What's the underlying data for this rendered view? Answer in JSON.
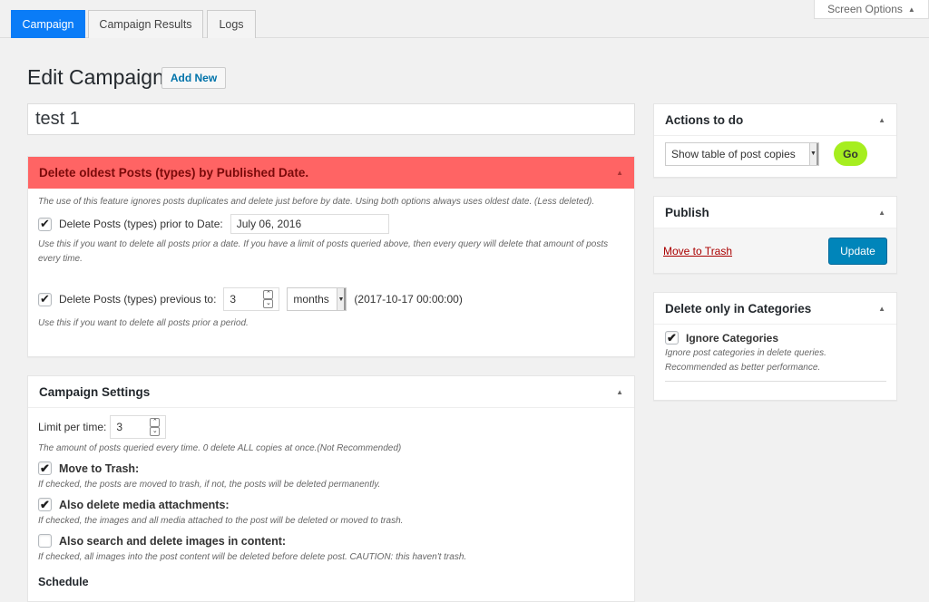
{
  "tabs": [
    {
      "label": "Campaign",
      "active": true
    },
    {
      "label": "Campaign Results"
    },
    {
      "label": "Logs"
    }
  ],
  "screen_options": "Screen Options",
  "page_title": "Edit Campaign",
  "add_new": "Add New",
  "campaign_title": "test 1",
  "delete_oldest": {
    "title": "Delete oldest Posts (types) by Published Date.",
    "header_color": "#ff6464",
    "intro": "The use of this feature ignores posts duplicates and delete just before by date. Using both options always uses oldest date. (Less deleted).",
    "prior_date_label": "Delete Posts (types) prior to Date:",
    "prior_date_checked": true,
    "prior_date_value": "July 06, 2016",
    "prior_date_help": "Use this if you want to delete all posts prior a date. If you have a limit of posts queried above, then every query will delete that amount of posts every time.",
    "previous_label": "Delete Posts (types) previous to:",
    "previous_checked": true,
    "previous_value": "3",
    "previous_unit": "months",
    "previous_computed": "(2017-10-17 00:00:00)",
    "previous_help": "Use this if you want to delete all posts prior a period."
  },
  "settings": {
    "title": "Campaign Settings",
    "limit_label": "Limit per time:",
    "limit_value": "3",
    "limit_help": "The amount of posts queried every time. 0 delete ALL copies at once.(Not Recommended)",
    "options": [
      {
        "label": "Move to Trash:",
        "checked": true,
        "help": "If checked, the posts are moved to trash, if not, the posts will be deleted permanently."
      },
      {
        "label": "Also delete media attachments:",
        "checked": true,
        "help": "If checked, the images and all media attached to the post will be deleted or moved to trash."
      },
      {
        "label": "Also search and delete images in content:",
        "checked": false,
        "help": "If checked, all images into the post content will be deleted before delete post. CAUTION: this haven't trash."
      }
    ],
    "schedule": "Schedule"
  },
  "actions": {
    "title": "Actions to do",
    "selected": "Show table of post copies",
    "go": "Go",
    "go_color": "#a6ee1f"
  },
  "publish": {
    "title": "Publish",
    "trash": "Move to Trash",
    "update": "Update"
  },
  "categories": {
    "title": "Delete only in Categories",
    "ignore_label": "Ignore Categories",
    "ignore_checked": true,
    "help": "Ignore post categories in delete queries. Recommended as better performance."
  }
}
